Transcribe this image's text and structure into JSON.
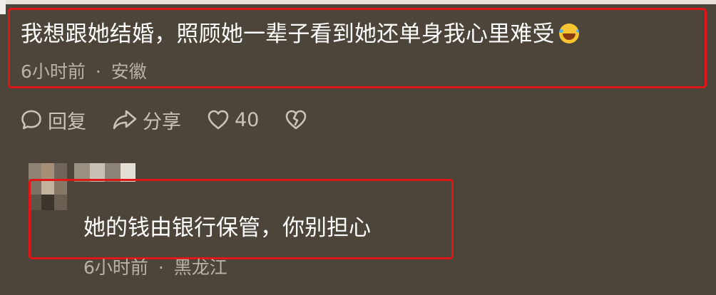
{
  "comment": {
    "text": "我想跟她结婚，照顾她一辈子看到她还单身我心里难受",
    "emoji": "laughing-crying-emoji",
    "time": "6小时前",
    "separator": "·",
    "location": "安徽"
  },
  "actions": {
    "reply_label": "回复",
    "share_label": "分享",
    "like_count": "40"
  },
  "reply": {
    "text": "她的钱由银行保管，你别担心",
    "time": "6小时前",
    "separator": "·",
    "location": "黑龙江"
  },
  "colors": {
    "background": "#4d4539",
    "highlight_border": "#e11616",
    "meta_text": "#b9b2a6",
    "action_text": "#c9c3b8"
  }
}
